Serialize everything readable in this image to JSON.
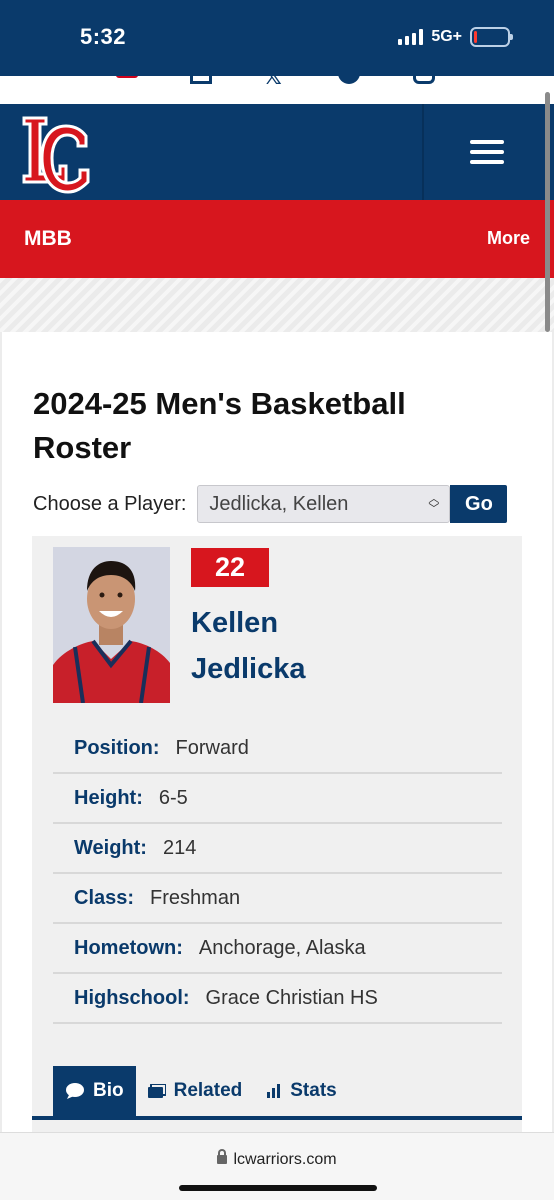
{
  "status_bar": {
    "time": "5:32",
    "network": "5G+",
    "battery_level": 0.1
  },
  "social_icons": [
    "ticket-icon",
    "calendar-icon",
    "x-icon",
    "facebook-icon",
    "instagram-icon"
  ],
  "header": {
    "logo_text": "LC",
    "menu_icon": "hamburger-icon"
  },
  "sport_bar": {
    "sport": "MBB",
    "more": "More"
  },
  "page": {
    "title": "2024-25 Men's Basketball Roster",
    "choose_label": "Choose a Player:",
    "selected_player": "Jedlicka, Kellen",
    "go_label": "Go"
  },
  "player": {
    "number": "22",
    "first_name": "Kellen",
    "last_name": "Jedlicka",
    "details": [
      {
        "label": "Position:",
        "value": "Forward"
      },
      {
        "label": "Height:",
        "value": "6-5"
      },
      {
        "label": "Weight:",
        "value": "214"
      },
      {
        "label": "Class:",
        "value": "Freshman"
      },
      {
        "label": "Hometown:",
        "value": "Anchorage, Alaska"
      },
      {
        "label": "Highschool:",
        "value": "Grace Christian HS"
      }
    ]
  },
  "tabs": [
    {
      "label": "Bio",
      "icon": "comment-icon",
      "active": true
    },
    {
      "label": "Related",
      "icon": "related-icon",
      "active": false
    },
    {
      "label": "Stats",
      "icon": "bar-chart-icon",
      "active": false
    }
  ],
  "browser": {
    "url": "lcwarriors.com"
  },
  "colors": {
    "navy": "#0a3a6b",
    "red": "#d7161e"
  }
}
